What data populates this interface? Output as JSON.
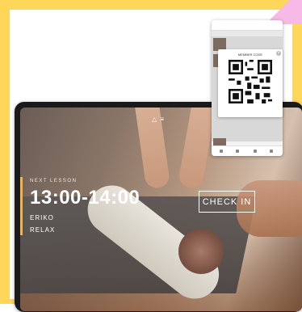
{
  "lesson": {
    "label": "NEXT LESSON",
    "time": "13:00-14:00",
    "instructor": "ERIKO",
    "class_name": "RELAX"
  },
  "actions": {
    "checkin_label": "CHECK IN"
  },
  "phone": {
    "modal_title": "MEMBER CODE"
  },
  "colors": {
    "frame": "#fdd65a",
    "accent": "#f5b63b",
    "ribbon": "#f7b9e6"
  }
}
